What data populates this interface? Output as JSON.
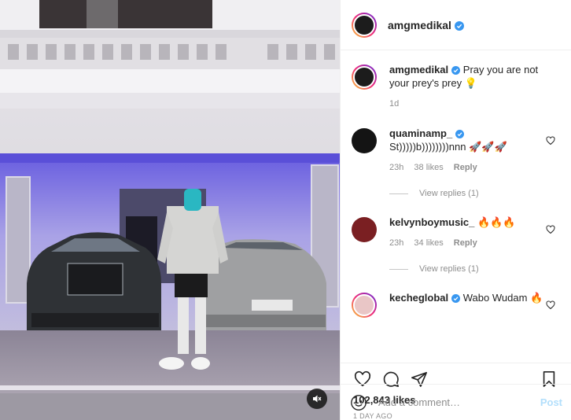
{
  "header": {
    "username": "amgmedikal",
    "verified_icon": "verified-badge-icon"
  },
  "caption": {
    "username": "amgmedikal",
    "text": "Pray you are not your prey's prey 💡",
    "time": "1d"
  },
  "comments": [
    {
      "username": "quaminamp_",
      "text": "St)))))b))))))))nnn 🚀🚀🚀",
      "time": "23h",
      "likes": "38 likes",
      "reply": "Reply",
      "view_replies": "View replies (1)"
    },
    {
      "username": "kelvynboymusic_",
      "text": "🔥🔥🔥",
      "time": "23h",
      "likes": "34 likes",
      "reply": "Reply",
      "view_replies": "View replies (1)"
    },
    {
      "username": "kecheglobal",
      "text": "Wabo Wudam 🔥"
    }
  ],
  "likes_count": "102,843 likes",
  "posted_ago": "1 DAY AGO",
  "add_comment": {
    "placeholder": "Add a comment…",
    "post_label": "Post"
  },
  "colors": {
    "verified": "#3897f0",
    "post_disabled": "#b2dffc",
    "muted_text": "#8e8e8e"
  }
}
